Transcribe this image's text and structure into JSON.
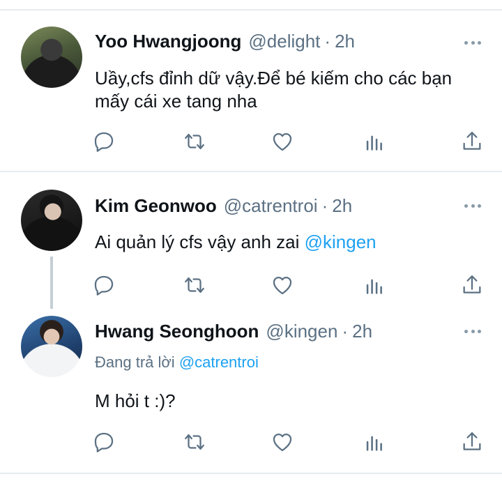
{
  "tweets": [
    {
      "name": "Yoo Hwangjoong",
      "handle": "@delight",
      "separator": "·",
      "time": "2h",
      "text": "Uầy,cfs đỉnh dữ vậy.Để bé kiếm cho các bạn mấy cái xe tang nha"
    },
    {
      "name": "Kim Geonwoo",
      "handle": "@catrentroi",
      "separator": "·",
      "time": "2h",
      "text": "Ai quản lý cfs vậy anh zai ",
      "mention": "@kingen"
    },
    {
      "name": "Hwang Seonghoon",
      "handle": "@kingen",
      "separator": "·",
      "time": "2h",
      "replying_label": "Đang trả lời ",
      "replying_to": "@catrentroi",
      "text": "M hỏi t :)?"
    }
  ],
  "icons": {
    "reply": "reply-icon",
    "retweet": "retweet-icon",
    "like": "heart-icon",
    "analytics": "analytics-icon",
    "share": "share-icon",
    "more": "more-icon"
  },
  "colors": {
    "mention": "#1da1f2",
    "muted": "#5b7083",
    "thread_line": "#c4cfd6"
  }
}
